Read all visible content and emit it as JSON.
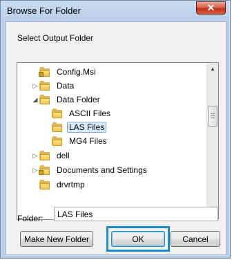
{
  "window": {
    "title": "Browse For Folder",
    "close_glyph": "✕"
  },
  "prompt": "Select Output Folder",
  "tree": {
    "items": [
      {
        "label": "Config.Msi",
        "expander": "",
        "locked": true,
        "selected": false
      },
      {
        "label": "Data",
        "expander": "▷",
        "locked": false,
        "selected": false
      },
      {
        "label": "Data Folder",
        "expander": "◢",
        "locked": false,
        "selected": false
      },
      {
        "label": "ASCII Files",
        "expander": "",
        "locked": false,
        "selected": false
      },
      {
        "label": "LAS Files",
        "expander": "",
        "locked": false,
        "selected": true
      },
      {
        "label": "MG4 Files",
        "expander": "",
        "locked": false,
        "selected": false
      },
      {
        "label": "dell",
        "expander": "▷",
        "locked": false,
        "selected": false
      },
      {
        "label": "Documents and Settings",
        "expander": "▷",
        "locked": true,
        "selected": false
      },
      {
        "label": "drvrtmp",
        "expander": "",
        "locked": false,
        "selected": false
      }
    ],
    "scroll_up_glyph": "▲",
    "scroll_down_glyph": "▼"
  },
  "folder_field": {
    "label": "Folder:",
    "value": "LAS Files"
  },
  "buttons": {
    "make_new_folder": "Make New Folder",
    "ok": "OK",
    "cancel": "Cancel"
  },
  "colors": {
    "highlight": "#1a8ccc",
    "selection": "#dbeaf9",
    "folder": "#f3c44a"
  }
}
